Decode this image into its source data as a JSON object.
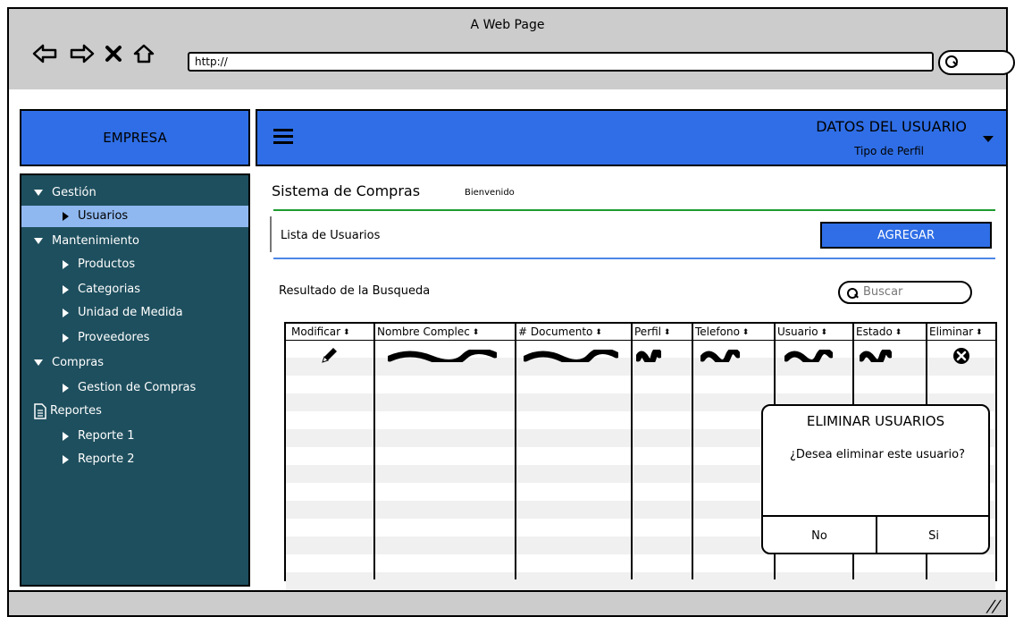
{
  "browser": {
    "window_title": "A Web Page",
    "url": "http://"
  },
  "header": {
    "brand": "EMPRESA",
    "user_title": "DATOS DEL USUARIO",
    "user_subtitle": "Tipo de Perfil"
  },
  "sidebar": {
    "items": [
      {
        "label": "Gestión",
        "level": 0,
        "icon": "triangle-down-icon"
      },
      {
        "label": "Usuarios",
        "level": 1,
        "icon": "triangle-right-icon",
        "selected": true
      },
      {
        "label": "Mantenimiento",
        "level": 0,
        "icon": "triangle-down-icon"
      },
      {
        "label": "Productos",
        "level": 1,
        "icon": "triangle-right-icon"
      },
      {
        "label": "Categorias",
        "level": 1,
        "icon": "triangle-right-icon"
      },
      {
        "label": "Unidad de Medida",
        "level": 1,
        "icon": "triangle-right-icon"
      },
      {
        "label": "Proveedores",
        "level": 1,
        "icon": "triangle-right-icon"
      },
      {
        "label": "Compras",
        "level": 0,
        "icon": "triangle-down-icon"
      },
      {
        "label": "Gestion de Compras",
        "level": 1,
        "icon": "triangle-right-icon"
      },
      {
        "label": "Reportes",
        "level": 0,
        "icon": "document-icon"
      },
      {
        "label": "Reporte 1",
        "level": 1,
        "icon": "triangle-right-icon"
      },
      {
        "label": "Reporte 2",
        "level": 1,
        "icon": "triangle-right-icon"
      }
    ]
  },
  "main": {
    "title": "Sistema de Compras",
    "welcome": "Bienvenido",
    "list_label": "Lista de Usuarios",
    "add_button": "AGREGAR",
    "results_label": "Resultado de la Busqueda",
    "search_placeholder": "Buscar",
    "columns": [
      "Modificar",
      "Nombre Complec",
      "# Documento",
      "Perfil",
      "Telefono",
      "Usuario",
      "Estado",
      "Eliminar"
    ]
  },
  "dialog": {
    "title": "ELIMINAR USUARIOS",
    "message": "¿Desea eliminar este usuario?",
    "no": "No",
    "yes": "Si"
  },
  "colors": {
    "accent": "#2f6ee6",
    "sidebar_bg": "#1e4f5e",
    "sidebar_selected": "#8fb8f0"
  }
}
